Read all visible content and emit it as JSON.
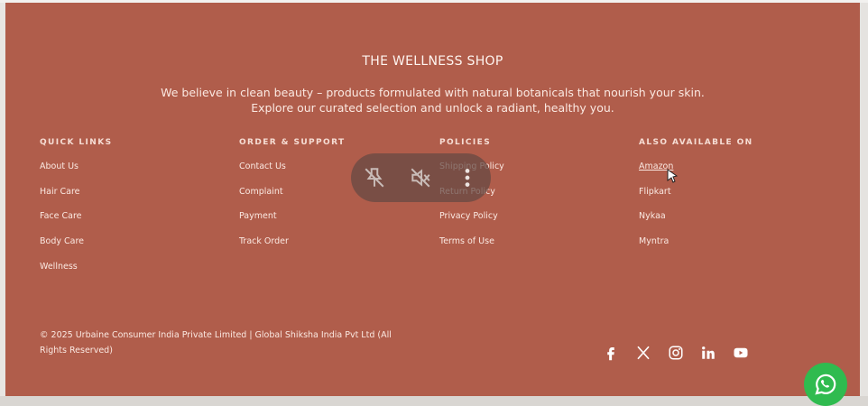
{
  "brand": {
    "title": "THE WELLNESS SHOP",
    "tagline_line1": "We believe in clean beauty – products formulated with natural botanicals that nourish your skin.",
    "tagline_line2": "Explore our curated selection and unlock a radiant, healthy you."
  },
  "columns": {
    "quick_links": {
      "heading": "QUICK LINKS",
      "items": [
        "About Us",
        "Hair Care",
        "Face Care",
        "Body Care",
        "Wellness"
      ]
    },
    "order_support": {
      "heading": "ORDER & SUPPORT",
      "items": [
        "Contact Us",
        "Complaint",
        "Payment",
        "Track Order"
      ]
    },
    "policies": {
      "heading": "POLICIES",
      "items": [
        "Shipping Policy",
        "Return Policy",
        "Privacy Policy",
        "Terms of Use"
      ]
    },
    "also_available": {
      "heading": "ALSO AVAILABLE ON",
      "items": [
        "Amazon",
        "Flipkart",
        "Nykaa",
        "Myntra"
      ]
    }
  },
  "copyright": "© 2025 Urbaine Consumer India Private Limited | Global Shiksha India Pvt Ltd (All Rights Reserved)",
  "socials": [
    "facebook-icon",
    "x-icon",
    "instagram-icon",
    "linkedin-icon",
    "youtube-icon"
  ],
  "overlay": [
    "unpin-icon",
    "mute-icon",
    "more-vertical-icon"
  ],
  "colors": {
    "footer_bg": "#b05d4b",
    "text": "#fbe9e2",
    "whatsapp": "#2fbb4f"
  }
}
